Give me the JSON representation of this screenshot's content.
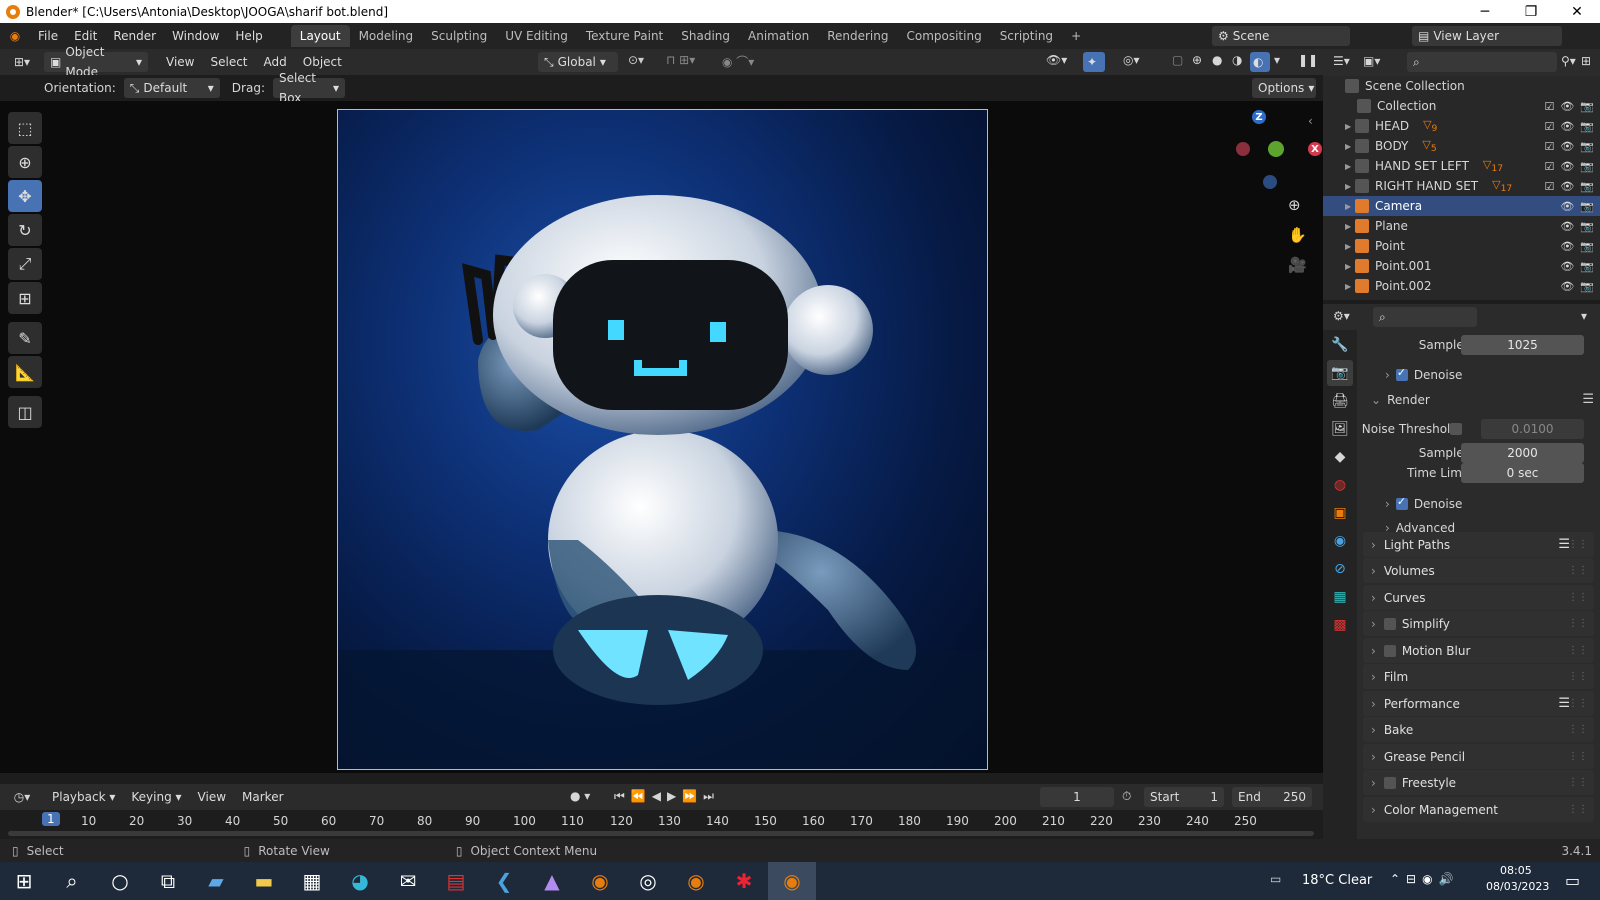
{
  "titlebar": {
    "title": "Blender* [C:\\Users\\Antonia\\Desktop\\JOOGA\\sharif bot.blend]"
  },
  "menus": [
    "File",
    "Edit",
    "Render",
    "Window",
    "Help"
  ],
  "workspaces": [
    "Layout",
    "Modeling",
    "Sculpting",
    "UV Editing",
    "Texture Paint",
    "Shading",
    "Animation",
    "Rendering",
    "Compositing",
    "Scripting"
  ],
  "scene": {
    "name": "Scene",
    "view_layer": "View Layer"
  },
  "viewport_header": {
    "mode": "Object Mode",
    "menus": [
      "View",
      "Select",
      "Add",
      "Object"
    ],
    "transform": "Global"
  },
  "tool_settings": {
    "orientation_label": "Orientation:",
    "orientation_value": "Default",
    "drag_label": "Drag:",
    "drag_value": "Select Box",
    "options": "Options"
  },
  "outliner": {
    "root": "Scene Collection",
    "items": [
      {
        "name": "Collection",
        "badge": ""
      },
      {
        "name": "HEAD",
        "badge": "9"
      },
      {
        "name": "BODY",
        "badge": "5"
      },
      {
        "name": "HAND SET LEFT",
        "badge": "17"
      },
      {
        "name": "RIGHT HAND SET",
        "badge": "17"
      },
      {
        "name": "Camera",
        "badge": ""
      },
      {
        "name": "Plane",
        "badge": ""
      },
      {
        "name": "Point",
        "badge": ""
      },
      {
        "name": "Point.001",
        "badge": ""
      },
      {
        "name": "Point.002",
        "badge": ""
      }
    ]
  },
  "properties": {
    "viewport_samples_label": "Samples",
    "viewport_samples": "1025",
    "denoise": "Denoise",
    "render_panel": "Render",
    "noise_threshold_label": "Noise Threshold",
    "noise_threshold": "0.0100",
    "samples_label": "Samples",
    "samples": "2000",
    "time_limit_label": "Time Limit",
    "time_limit": "0 sec",
    "denoise2": "Denoise",
    "advanced": "Advanced",
    "panels": [
      "Light Paths",
      "Volumes",
      "Curves",
      "Simplify",
      "Motion Blur",
      "Film",
      "Performance",
      "Bake",
      "Grease Pencil",
      "Freestyle",
      "Color Management"
    ]
  },
  "timeline": {
    "menus": [
      "Playback",
      "Keying",
      "View",
      "Marker"
    ],
    "current_frame": "1",
    "start_label": "Start",
    "start": "1",
    "end_label": "End",
    "end": "250",
    "ruler": [
      "1",
      "10",
      "20",
      "30",
      "40",
      "50",
      "60",
      "70",
      "80",
      "90",
      "100",
      "110",
      "120",
      "130",
      "140",
      "150",
      "160",
      "170",
      "180",
      "190",
      "200",
      "210",
      "220",
      "230",
      "240",
      "250"
    ]
  },
  "statusbar": {
    "select": "Select",
    "rotate": "Rotate View",
    "context": "Object Context Menu",
    "version": "3.4.1"
  },
  "taskbar": {
    "weather": "18°C  Clear",
    "time": "08:05",
    "date": "08/03/2023"
  },
  "colors": {
    "accent": "#4772b3",
    "selection": "#334d80",
    "camera_frame": "#c5c27a"
  }
}
